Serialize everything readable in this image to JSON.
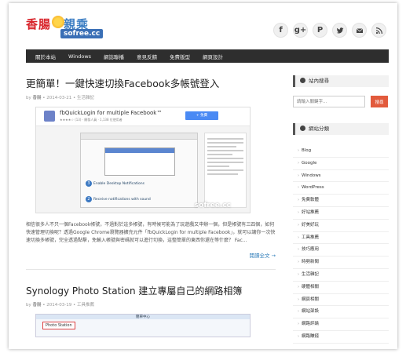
{
  "logo": {
    "chinese_part1": "香腸",
    "chinese_part2": "親乘",
    "english": "sofree.cc"
  },
  "social": [
    {
      "icon": "facebook-icon",
      "glyph": "f"
    },
    {
      "icon": "google-plus-icon",
      "glyph": "g+"
    },
    {
      "icon": "plurk-icon",
      "glyph": "P"
    },
    {
      "icon": "twitter-icon",
      "glyph": ""
    },
    {
      "icon": "email-icon",
      "glyph": ""
    },
    {
      "icon": "rss-icon",
      "glyph": ""
    }
  ],
  "nav": [
    "關於本站",
    "Windows",
    "網誌聯播",
    "意見反饋",
    "免費版型",
    "網頁設計"
  ],
  "post1": {
    "title": "更簡單！一鍵快速切換Facebook多帳號登入",
    "author": "香腸",
    "meta": " • 2014-03-21 • 生活雜記",
    "thumb_title": "fbQuickLogin for multiple Facebook™",
    "thumb_stars": "★★★★☆ (13) · 開發人員 · 1,138 位使用者",
    "thumb_button": "+ 免費",
    "step3": "Enable Desktop Notifications",
    "step2": "Receive notifications with sound",
    "watermark": "sofree.cc",
    "excerpt": "相信很多人不只一個Facebook帳號，不過對於這多帳號，有時候可能為了玩遊戲又申辦一個，但是帳號有三四個，如何快速管理切換呢？透過Google Chrome瀏覽器擴充元件「fbQuickLogin for multiple Facebook」，就可以讓你一次快速切換多帳號，完全透過點擊，免輸入帳號與密碼就可以進行切換，這整簡單的東西你還在等什麼？ Fac...",
    "read_more": "閱讀全文 →"
  },
  "post2": {
    "title": "Synology Photo Station 建立專屬自己的網路相簿",
    "author": "香腸",
    "meta": " • 2014-03-19 • 工具推薦",
    "thumb_center": "簡單中心",
    "thumb_tab": "Photo Station"
  },
  "sidebar": {
    "search_title": "站內搜尋",
    "search_placeholder": "請輸入關鍵字...",
    "search_button": "搜尋",
    "cat_title": "網站分類",
    "categories": [
      "Blog",
      "Google",
      "Windows",
      "WordPress",
      "免費軟體",
      "好站推薦",
      "好美好玩",
      "工具推薦",
      "技巧應用",
      "時勢新聞",
      "生活雜記",
      "硬體相關",
      "網頁相關",
      "網站架設",
      "網路評論",
      "網路賺錢"
    ]
  },
  "colors": {
    "nav_bg": "#2e2e2e",
    "search_button": "#e25a3c",
    "link": "#2a7ab8"
  }
}
